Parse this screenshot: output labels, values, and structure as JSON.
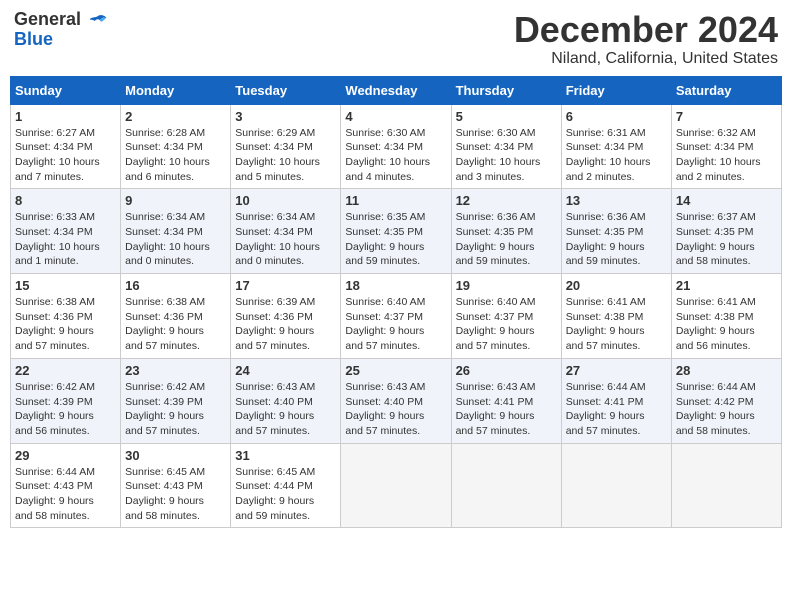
{
  "logo": {
    "general": "General",
    "blue": "Blue"
  },
  "header": {
    "title": "December 2024",
    "subtitle": "Niland, California, United States"
  },
  "weekdays": [
    "Sunday",
    "Monday",
    "Tuesday",
    "Wednesday",
    "Thursday",
    "Friday",
    "Saturday"
  ],
  "weeks": [
    [
      {
        "day": "1",
        "info": "Sunrise: 6:27 AM\nSunset: 4:34 PM\nDaylight: 10 hours\nand 7 minutes."
      },
      {
        "day": "2",
        "info": "Sunrise: 6:28 AM\nSunset: 4:34 PM\nDaylight: 10 hours\nand 6 minutes."
      },
      {
        "day": "3",
        "info": "Sunrise: 6:29 AM\nSunset: 4:34 PM\nDaylight: 10 hours\nand 5 minutes."
      },
      {
        "day": "4",
        "info": "Sunrise: 6:30 AM\nSunset: 4:34 PM\nDaylight: 10 hours\nand 4 minutes."
      },
      {
        "day": "5",
        "info": "Sunrise: 6:30 AM\nSunset: 4:34 PM\nDaylight: 10 hours\nand 3 minutes."
      },
      {
        "day": "6",
        "info": "Sunrise: 6:31 AM\nSunset: 4:34 PM\nDaylight: 10 hours\nand 2 minutes."
      },
      {
        "day": "7",
        "info": "Sunrise: 6:32 AM\nSunset: 4:34 PM\nDaylight: 10 hours\nand 2 minutes."
      }
    ],
    [
      {
        "day": "8",
        "info": "Sunrise: 6:33 AM\nSunset: 4:34 PM\nDaylight: 10 hours\nand 1 minute."
      },
      {
        "day": "9",
        "info": "Sunrise: 6:34 AM\nSunset: 4:34 PM\nDaylight: 10 hours\nand 0 minutes."
      },
      {
        "day": "10",
        "info": "Sunrise: 6:34 AM\nSunset: 4:34 PM\nDaylight: 10 hours\nand 0 minutes."
      },
      {
        "day": "11",
        "info": "Sunrise: 6:35 AM\nSunset: 4:35 PM\nDaylight: 9 hours\nand 59 minutes."
      },
      {
        "day": "12",
        "info": "Sunrise: 6:36 AM\nSunset: 4:35 PM\nDaylight: 9 hours\nand 59 minutes."
      },
      {
        "day": "13",
        "info": "Sunrise: 6:36 AM\nSunset: 4:35 PM\nDaylight: 9 hours\nand 59 minutes."
      },
      {
        "day": "14",
        "info": "Sunrise: 6:37 AM\nSunset: 4:35 PM\nDaylight: 9 hours\nand 58 minutes."
      }
    ],
    [
      {
        "day": "15",
        "info": "Sunrise: 6:38 AM\nSunset: 4:36 PM\nDaylight: 9 hours\nand 57 minutes."
      },
      {
        "day": "16",
        "info": "Sunrise: 6:38 AM\nSunset: 4:36 PM\nDaylight: 9 hours\nand 57 minutes."
      },
      {
        "day": "17",
        "info": "Sunrise: 6:39 AM\nSunset: 4:36 PM\nDaylight: 9 hours\nand 57 minutes."
      },
      {
        "day": "18",
        "info": "Sunrise: 6:40 AM\nSunset: 4:37 PM\nDaylight: 9 hours\nand 57 minutes."
      },
      {
        "day": "19",
        "info": "Sunrise: 6:40 AM\nSunset: 4:37 PM\nDaylight: 9 hours\nand 57 minutes."
      },
      {
        "day": "20",
        "info": "Sunrise: 6:41 AM\nSunset: 4:38 PM\nDaylight: 9 hours\nand 57 minutes."
      },
      {
        "day": "21",
        "info": "Sunrise: 6:41 AM\nSunset: 4:38 PM\nDaylight: 9 hours\nand 56 minutes."
      }
    ],
    [
      {
        "day": "22",
        "info": "Sunrise: 6:42 AM\nSunset: 4:39 PM\nDaylight: 9 hours\nand 56 minutes."
      },
      {
        "day": "23",
        "info": "Sunrise: 6:42 AM\nSunset: 4:39 PM\nDaylight: 9 hours\nand 57 minutes."
      },
      {
        "day": "24",
        "info": "Sunrise: 6:43 AM\nSunset: 4:40 PM\nDaylight: 9 hours\nand 57 minutes."
      },
      {
        "day": "25",
        "info": "Sunrise: 6:43 AM\nSunset: 4:40 PM\nDaylight: 9 hours\nand 57 minutes."
      },
      {
        "day": "26",
        "info": "Sunrise: 6:43 AM\nSunset: 4:41 PM\nDaylight: 9 hours\nand 57 minutes."
      },
      {
        "day": "27",
        "info": "Sunrise: 6:44 AM\nSunset: 4:41 PM\nDaylight: 9 hours\nand 57 minutes."
      },
      {
        "day": "28",
        "info": "Sunrise: 6:44 AM\nSunset: 4:42 PM\nDaylight: 9 hours\nand 58 minutes."
      }
    ],
    [
      {
        "day": "29",
        "info": "Sunrise: 6:44 AM\nSunset: 4:43 PM\nDaylight: 9 hours\nand 58 minutes."
      },
      {
        "day": "30",
        "info": "Sunrise: 6:45 AM\nSunset: 4:43 PM\nDaylight: 9 hours\nand 58 minutes."
      },
      {
        "day": "31",
        "info": "Sunrise: 6:45 AM\nSunset: 4:44 PM\nDaylight: 9 hours\nand 59 minutes."
      },
      {
        "day": "",
        "info": ""
      },
      {
        "day": "",
        "info": ""
      },
      {
        "day": "",
        "info": ""
      },
      {
        "day": "",
        "info": ""
      }
    ]
  ]
}
